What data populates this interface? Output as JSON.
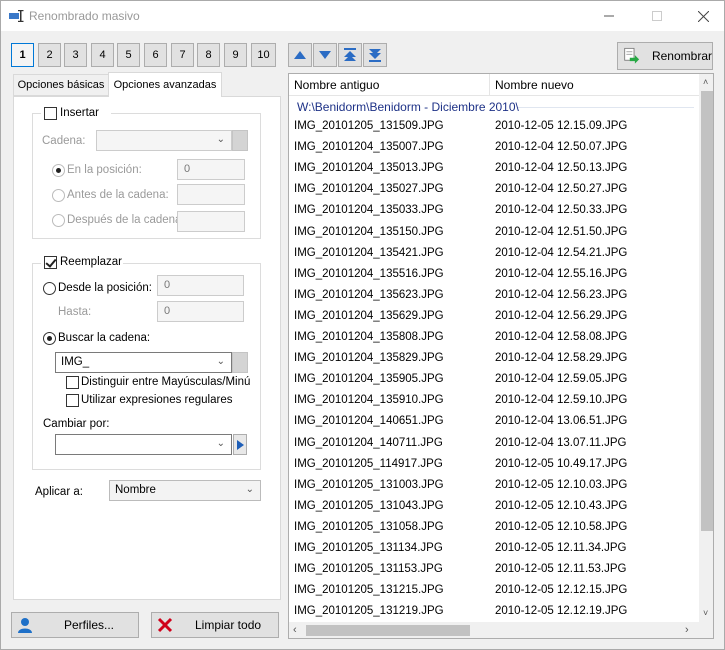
{
  "window": {
    "title": "Renombrado masivo"
  },
  "number_tabs": [
    "1",
    "2",
    "3",
    "4",
    "5",
    "6",
    "7",
    "8",
    "9",
    "10"
  ],
  "active_number_tab": "1",
  "rename_button": {
    "label": "Renombrar"
  },
  "tabs": [
    {
      "label": "Opciones básicas"
    },
    {
      "label": "Opciones avanzadas"
    }
  ],
  "insert_group": {
    "checkbox_label": "Insertar",
    "chain_label": "Cadena:",
    "chain_value": "",
    "position_label": "En la posición:",
    "position_value": "0",
    "before_label": "Antes de la cadena:",
    "after_label": "Después de la cadena:"
  },
  "replace_group": {
    "checkbox_label": "Reemplazar",
    "from_position_label": "Desde la posición:",
    "from_position_value": "0",
    "until_label": "Hasta:",
    "until_value": "0",
    "search_label": "Buscar la cadena:",
    "search_value": "IMG_",
    "case_label": "Distinguir entre Mayúsculas/Minú",
    "regex_label": "Utilizar expresiones regulares",
    "change_label": "Cambiar por:",
    "change_value": ""
  },
  "apply_to": {
    "label": "Aplicar a:",
    "value": "Nombre"
  },
  "profiles_button": {
    "label": "Perfiles..."
  },
  "clear_button": {
    "label": "Limpiar todo"
  },
  "file_list": {
    "columns": [
      "Nombre antiguo",
      "Nombre nuevo"
    ],
    "group_path": "W:\\Benidorm\\Benidorm - Diciembre 2010\\",
    "rows": [
      [
        "IMG_20101205_131509.JPG",
        "2010-12-05 12.15.09.JPG"
      ],
      [
        "IMG_20101204_135007.JPG",
        "2010-12-04 12.50.07.JPG"
      ],
      [
        "IMG_20101204_135013.JPG",
        "2010-12-04 12.50.13.JPG"
      ],
      [
        "IMG_20101204_135027.JPG",
        "2010-12-04 12.50.27.JPG"
      ],
      [
        "IMG_20101204_135033.JPG",
        "2010-12-04 12.50.33.JPG"
      ],
      [
        "IMG_20101204_135150.JPG",
        "2010-12-04 12.51.50.JPG"
      ],
      [
        "IMG_20101204_135421.JPG",
        "2010-12-04 12.54.21.JPG"
      ],
      [
        "IMG_20101204_135516.JPG",
        "2010-12-04 12.55.16.JPG"
      ],
      [
        "IMG_20101204_135623.JPG",
        "2010-12-04 12.56.23.JPG"
      ],
      [
        "IMG_20101204_135629.JPG",
        "2010-12-04 12.56.29.JPG"
      ],
      [
        "IMG_20101204_135808.JPG",
        "2010-12-04 12.58.08.JPG"
      ],
      [
        "IMG_20101204_135829.JPG",
        "2010-12-04 12.58.29.JPG"
      ],
      [
        "IMG_20101204_135905.JPG",
        "2010-12-04 12.59.05.JPG"
      ],
      [
        "IMG_20101204_135910.JPG",
        "2010-12-04 12.59.10.JPG"
      ],
      [
        "IMG_20101204_140651.JPG",
        "2010-12-04 13.06.51.JPG"
      ],
      [
        "IMG_20101204_140711.JPG",
        "2010-12-04 13.07.11.JPG"
      ],
      [
        "IMG_20101205_114917.JPG",
        "2010-12-05 10.49.17.JPG"
      ],
      [
        "IMG_20101205_131003.JPG",
        "2010-12-05 12.10.03.JPG"
      ],
      [
        "IMG_20101205_131043.JPG",
        "2010-12-05 12.10.43.JPG"
      ],
      [
        "IMG_20101205_131058.JPG",
        "2010-12-05 12.10.58.JPG"
      ],
      [
        "IMG_20101205_131134.JPG",
        "2010-12-05 12.11.34.JPG"
      ],
      [
        "IMG_20101205_131153.JPG",
        "2010-12-05 12.11.53.JPG"
      ],
      [
        "IMG_20101205_131215.JPG",
        "2010-12-05 12.12.15.JPG"
      ],
      [
        "IMG_20101205_131219.JPG",
        "2010-12-05 12.12.19.JPG"
      ]
    ]
  },
  "colors": {
    "accent": "#0078d7",
    "group_header": "#1e3287",
    "arrow_blue": "#2b6cc4",
    "clear_red": "#d0021b"
  }
}
